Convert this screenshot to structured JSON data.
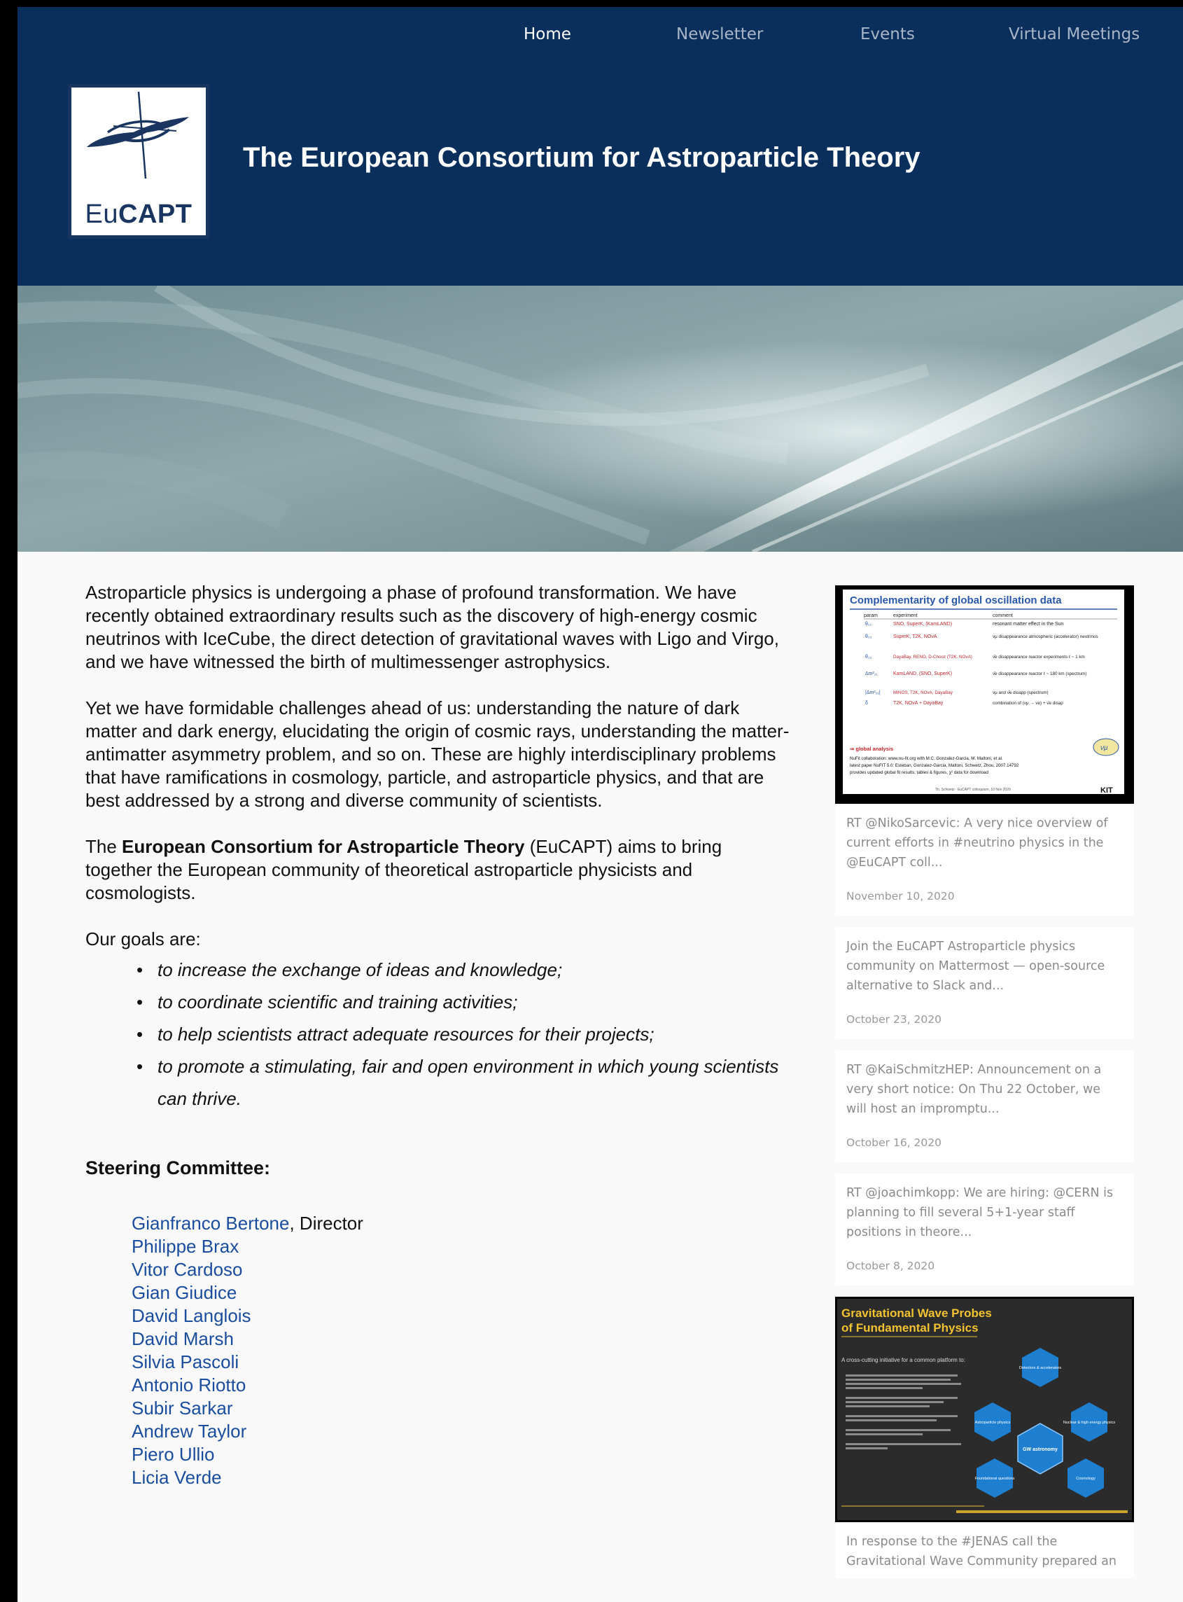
{
  "nav": {
    "items": [
      "Home",
      "Newsletter",
      "Events",
      "Virtual Meetings"
    ]
  },
  "logo": {
    "text_light": "Eu",
    "text_bold": "CAPT"
  },
  "site_title": "The European Consortium for Astroparticle Theory",
  "main": {
    "para1": "Astroparticle physics is undergoing a phase of profound transformation. We have recently obtained extraordinary results such as the discovery of high-energy cosmic neutrinos with IceCube, the direct detection of gravitational waves with Ligo and Virgo, and we have witnessed the birth of multimessenger astrophysics.",
    "para2": "Yet we have formidable challenges ahead of us: understanding the nature of dark matter and dark energy, elucidating the origin of cosmic rays, understanding the matter-antimatter asymmetry problem, and so on. These are highly interdisciplinary problems that have ramifications in cosmology, particle, and astroparticle physics, and that are best addressed by a strong and diverse community of scientists.",
    "para3_prefix": "The ",
    "para3_bold": "European Consortium for Astroparticle Theory",
    "para3_suffix": " (EuCAPT) aims to bring together the European community of theoretical astroparticle physicists and cosmologists.",
    "goals_intro": "Our goals are:",
    "goals": [
      "to increase the exchange of ideas and knowledge;",
      "to coordinate scientific and training activities;",
      "to help scientists attract adequate resources for their projects;",
      "to promote a stimulating, fair and open environment in which young scientists can thrive."
    ],
    "committee_heading": "Steering Committee:",
    "director_suffix": ", Director",
    "committee": [
      "Gianfranco Bertone",
      "Philippe Brax",
      "Vitor Cardoso",
      "Gian Giudice",
      "David Langlois",
      "David Marsh",
      "Silvia Pascoli",
      "Antonio Riotto",
      "Subir Sarkar",
      "Andrew Taylor",
      "Piero Ullio",
      "Licia Verde"
    ]
  },
  "sidebar": {
    "slide1": {
      "title": "Complementarity of global oscillation data",
      "col_headers": [
        "param",
        "experiment",
        "comment"
      ],
      "rows": [
        [
          "θ₁₂",
          "SNO, SuperK, (KamLAND)",
          "resonant matter effect in the Sun"
        ],
        [
          "θ₂₃",
          "SuperK, T2K, NOvA",
          "νμ disappearance atmospheric (accelerator) neutrinos"
        ],
        [
          "θ₁₃",
          "DayaBay, RENO, D-Chooz (T2K, NOvA)",
          "ν̄e disappearance reactor experiments ℓ ~ 1 km"
        ],
        [
          "Δm²₂₁",
          "KamLAND, (SNO, SuperK)",
          "ν̄e disappearance reactor ℓ ~ 180 km (spectrum)"
        ],
        [
          "|Δm²₃₁|",
          "MINOS, T2K, NOvA, DayaBay",
          "νμ and ν̄e disapp (spectrum)"
        ],
        [
          "δ",
          "T2K, NOvA + DayaBay",
          "combination of (νμ → νe) + ν̄e disap"
        ]
      ],
      "footer_lines": [
        "⇒ global analysis",
        "NuFit collaboration: www.nu-fit.org with M.C. Gonzalez-Garcia, M. Maltoni, et al.",
        "latest paper NuFIT 5.0: Esteban, Gonzalez-Garcia, Maltoni, Schwetz, Zhou, 2007.14792",
        "provides updated global fit results, tables & figures, χ² data for download"
      ],
      "credit": "Th. Schwetz · EuCAPT colloquium, 10 Nov 2020",
      "badge": "KIT"
    },
    "tweets": [
      {
        "text": "RT @NikoSarcevic: A very nice overview of current efforts in #neutrino physics in the @EuCAPT coll...",
        "date": "November 10, 2020"
      },
      {
        "text": "Join the EuCAPT Astroparticle physics community on Mattermost — open-source alternative to Slack and...",
        "date": "October 23, 2020"
      },
      {
        "text": "RT @KaiSchmitzHEP: Announcement on a very short notice: On Thu 22 October, we will host an impromptu...",
        "date": "October 16, 2020"
      },
      {
        "text": "RT @joachimkopp: We are hiring: @CERN is planning to fill several 5+1-year staff positions in theore...",
        "date": "October 8, 2020"
      }
    ],
    "slide2": {
      "title_line1": "Gravitational Wave Probes",
      "title_line2": "of Fundamental Physics",
      "intro": "A cross-cutting initiative for a common platform to:",
      "hexes": [
        "Detectors & accelerators",
        "Astroparticle physics",
        "GW astronomy",
        "Nuclear & high energy physics",
        "Foundational questions",
        "Cosmology"
      ]
    },
    "tweet_last": "In response to the #JENAS call the Gravitational Wave Community prepared an"
  },
  "colors": {
    "header_bg": "#0a2f5c",
    "link": "#1a4d9e",
    "slide_title": "#2a58a8",
    "slide2_title": "#f2c230",
    "hex": "#1e7fd0"
  }
}
